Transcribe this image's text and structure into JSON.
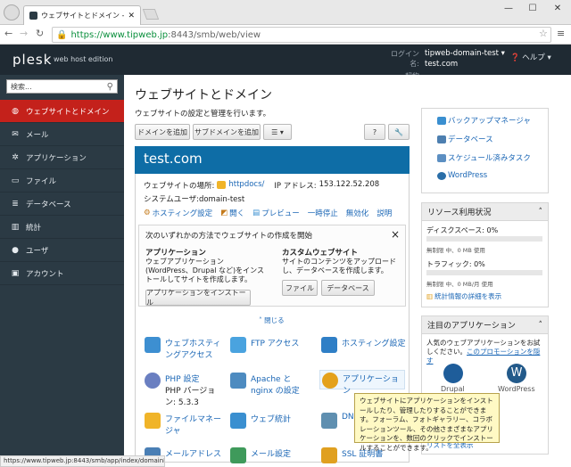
{
  "browser": {
    "tab_title": "ウェブサイトとドメイン - Plesk",
    "url_host": "https://www.tipweb.jp",
    "url_path": ":8443/smb/web/view",
    "status_url": "https://www.tipweb.jp:8443/smb/app/index/domainId/72"
  },
  "header": {
    "logo": "plesk",
    "edition": "web host edition",
    "login_label": "ログイン名:",
    "login_value": "tipweb-domain-test",
    "contract_label": "契約",
    "contract_value": "test.com",
    "help": "ヘルプ"
  },
  "search": {
    "placeholder": "検索..."
  },
  "nav": [
    {
      "label": "ウェブサイトとドメイン"
    },
    {
      "label": "メール"
    },
    {
      "label": "アプリケーション"
    },
    {
      "label": "ファイル"
    },
    {
      "label": "データベース"
    },
    {
      "label": "統計"
    },
    {
      "label": "ユーザ"
    },
    {
      "label": "アカウント"
    }
  ],
  "page": {
    "title": "ウェブサイトとドメイン",
    "subtitle": "ウェブサイトの設定と管理を行います。"
  },
  "toolbar": {
    "add_domain": "ドメインを追加",
    "add_subdomain": "サブドメインを追加",
    "more": "☰ ▾",
    "help": "?",
    "tools": "🔧"
  },
  "domain": {
    "name": "test.com",
    "location_label": "ウェブサイトの場所:",
    "location_value": "httpdocs/",
    "ip_label": "IP アドレス:",
    "ip_value": "153.122.52.208",
    "user_label": "システムユーザ:",
    "user_value": "domain-test",
    "actions": [
      "ホスティング設定",
      "開く",
      "プレビュー",
      "一時停止",
      "無効化",
      "説明"
    ]
  },
  "create": {
    "heading": "次のいずれかの方法でウェブサイトの作成を開始",
    "close": "×",
    "app_title": "アプリケーション",
    "app_desc": "ウェブアプリケーション(WordPress、Drupal など)をインストールしてサイトを作成します。",
    "app_button": "アプリケーションをインストール",
    "custom_title": "カスタムウェブサイト",
    "custom_desc": "サイトのコンテンツをアップロードし、データベースを作成します。",
    "files_button": "ファイル",
    "db_button": "データベース",
    "collapse": "閉じる"
  },
  "tools": [
    {
      "label": "ウェブホスティングアクセス",
      "color": "#3d8fd1"
    },
    {
      "label": "FTP アクセス",
      "color": "#4aa3df"
    },
    {
      "label": "ホスティング設定",
      "color": "#2f7fc6"
    },
    {
      "label": "PHP 設定",
      "sub": "PHP バージョン: 5.3.3",
      "color": "#6a7fc1"
    },
    {
      "label": "Apache と nginx の設定",
      "color": "#4d8bc0"
    },
    {
      "label": "アプリケーション",
      "color": "#e4a11b"
    },
    {
      "label": "ファイルマネージャ",
      "color": "#f0b429"
    },
    {
      "label": "ウェブ統計",
      "color": "#3a8fd0"
    },
    {
      "label": "DN",
      "color": "#5f8fb0"
    },
    {
      "label": "メールアドレス",
      "color": "#4a7fb5"
    },
    {
      "label": "メール設定",
      "color": "#3f9a5b"
    },
    {
      "label": "SSL 証明書",
      "color": "#e0a020"
    }
  ],
  "right": {
    "links": [
      "バックアップマネージャ",
      "データベース",
      "スケジュール済みタスク",
      "WordPress"
    ],
    "usage_title": "リソース利用状況",
    "disk_label": "ディスクスペース: 0%",
    "disk_sub": "無制限 中、0 MB 使用",
    "traffic_label": "トラフィック: 0%",
    "traffic_sub": "無制限 中、0 MB/月 使用",
    "stats_link": "統計情報の詳細を表示",
    "apps_title": "注目のアプリケーション",
    "apps_desc": "人気のウェブアプリケーションをお試しください。",
    "promo_link": "このプロモーションを隠す",
    "app1": "Drupal",
    "app2": "WordPress",
    "list_link": "リストを全表示"
  },
  "tooltip": "ウェブサイトにアプリケーションをインストールしたり、管理したりすることができます。フォーラム、フォトギャラリー、コラボレーションツール、その他さまざまなアプリケーションを、数回のクリックでインストールすることができます。"
}
